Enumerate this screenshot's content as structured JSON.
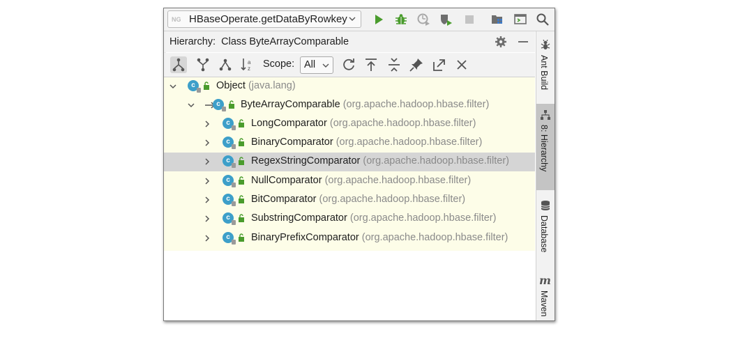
{
  "toolbar": {
    "run_config_badge": "NG",
    "run_config_label": "HBaseOperate.getDataByRowkey",
    "icons": [
      "run-icon",
      "debug-icon",
      "coverage-icon",
      "profile-icon",
      "stop-icon",
      "project-structure-icon",
      "presentation-icon",
      "search-icon"
    ]
  },
  "panel": {
    "header_label": "Hierarchy:",
    "header_target": "Class ByteArrayComparable",
    "scope_label": "Scope:",
    "scope_value": "All"
  },
  "tree": {
    "root": {
      "name": "Object",
      "package": "(java.lang)"
    },
    "base": {
      "name": "ByteArrayComparable",
      "package": "(org.apache.hadoop.hbase.filter)"
    },
    "children": [
      {
        "name": "LongComparator",
        "package": "(org.apache.hadoop.hbase.filter)"
      },
      {
        "name": "BinaryComparator",
        "package": "(org.apache.hadoop.hbase.filter)"
      },
      {
        "name": "RegexStringComparator",
        "package": "(org.apache.hadoop.hbase.filter)"
      },
      {
        "name": "NullComparator",
        "package": "(org.apache.hadoop.hbase.filter)"
      },
      {
        "name": "BitComparator",
        "package": "(org.apache.hadoop.hbase.filter)"
      },
      {
        "name": "SubstringComparator",
        "package": "(org.apache.hadoop.hbase.filter)"
      },
      {
        "name": "BinaryPrefixComparator",
        "package": "(org.apache.hadoop.hbase.filter)"
      }
    ],
    "selected_child_index": 2
  },
  "sidebar": {
    "tabs": [
      {
        "label": "Ant Build",
        "icon": "ant-icon",
        "active": false
      },
      {
        "label": "8: Hierarchy",
        "icon": "hierarchy-icon",
        "active": true
      },
      {
        "label": "Database",
        "icon": "database-icon",
        "active": false
      },
      {
        "label": "Maven",
        "icon": "maven-icon",
        "active": false
      }
    ]
  },
  "colors": {
    "run_green": "#4a9c2d",
    "class_icon_blue": "#3d9fc9",
    "tree_background": "#fdfde8",
    "selection_gray": "#d5d5d5",
    "package_gray": "#8a8a8a"
  }
}
